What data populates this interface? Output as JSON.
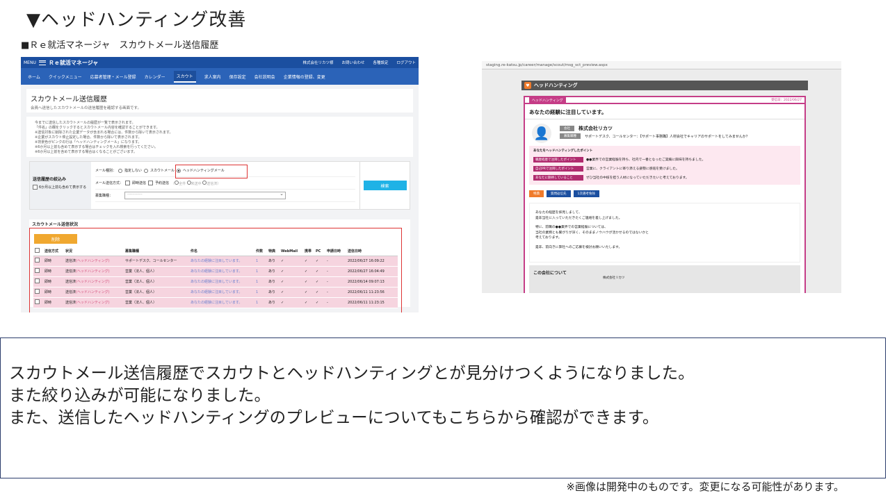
{
  "slide": {
    "title": "▼ヘッドハンティング改善",
    "subtitle": "■Ｒｅ就活マネージャ　スカウトメール送信履歴"
  },
  "left": {
    "topbar": {
      "menu": "MENU",
      "brand": "Ｒｅ就活マネージャ",
      "items": [
        "株式会社リカツ様",
        "お問い合わせ",
        "各種設定",
        "ログアウト"
      ]
    },
    "nav": [
      "ホーム",
      "クイックメニュー",
      "応募者管理・メール登録",
      "カレンダー",
      "スカウト",
      "求人案内",
      "保存設定",
      "会社説明会",
      "企業情報の登録、変更"
    ],
    "page_title": "スカウトメール送信履歴",
    "page_desc": "会員へ送信したスカウトメールの送信履歴を確認する画面です。",
    "notes": [
      "今までに送信したスカウトメールの履歴が一覧で表示されます。",
      "「件名」の欄をクリックするとスカウトメール内容を確認することができます。",
      "※送信対象に削除された企業データが含まれる場合には、件数から除いて表示されます。",
      "※企業がスカウト停止設定した場合、件数から除いて表示されます。",
      "※背景色がピンクの行は「ヘッドハンティングメール」になります。",
      "※6か月以上前も含めて表示する場合はチェックを入れ検索を行ってください。",
      "※6か月以上前を含めて表示する場合はくなることがございます。"
    ],
    "filter": {
      "label": "送信履歴の絞込み",
      "checkbox": "6か月以上前も含めて表示する",
      "type_label": "メール種別：",
      "type_options": [
        "指定しない",
        "スカウトメール",
        "ヘッドハンティングメール"
      ],
      "send_label": "メール送信方式：",
      "send_options": [
        "即時送信",
        "予約送信"
      ],
      "send_sub": [
        "全件",
        "未送中",
        "送信済"
      ],
      "job_label": "募集職種：",
      "job_placeholder": "------------",
      "search_button": "検索"
    },
    "status": {
      "title": "スカウトメール送信状況",
      "delete_button": "削除",
      "headers": [
        "",
        "送信方式",
        "状況",
        "募集職種",
        "件名",
        "件数",
        "特典",
        "WebMail",
        "携帯",
        "PC",
        "申請日時",
        "送信日時"
      ],
      "rows": [
        [
          "",
          "即時",
          "送信済",
          "(ヘッドハンティング)",
          "サポートデスク、コールセンター",
          "あなたの経験に注目しています。",
          "1",
          "あり",
          "✓",
          "✓",
          "✓",
          "-",
          "2022/06/27 16:09:22"
        ],
        [
          "",
          "即時",
          "送信済",
          "(ヘッドハンティング)",
          "営業（法人、個人）",
          "あなたの経験に注目しています。",
          "1",
          "あり",
          "✓",
          "✓",
          "✓",
          "-",
          "2022/06/27 16:04:49"
        ],
        [
          "",
          "即時",
          "送信済",
          "(ヘッドハンティング)",
          "営業（法人、個人）",
          "あなたの経験に注目しています。",
          "1",
          "あり",
          "✓",
          "✓",
          "✓",
          "-",
          "2022/06/14 09:07:13"
        ],
        [
          "",
          "即時",
          "送信済",
          "(ヘッドハンティング)",
          "営業（法人、個人）",
          "あなたの経験に注目しています。",
          "1",
          "あり",
          "✓",
          "✓",
          "✓",
          "-",
          "2022/06/11 11:23:56"
        ],
        [
          "",
          "即時",
          "送信済",
          "(ヘッドハンティング)",
          "営業（法人、個人）",
          "あなたの経験に注目しています。",
          "1",
          "あり",
          "✓",
          "✓",
          "✓",
          "-",
          "2022/06/11 11:23:15"
        ]
      ]
    }
  },
  "right": {
    "url": "staging.re-katsu.jp/career/manage/scout/msg_sct_preview.aspx",
    "header": "ヘッドハンティング",
    "tag": "ヘッドハンティング",
    "date": "受信日：2022/06/27",
    "title": "あなたの経験に注目しています。",
    "company_tag": "会社",
    "company": "株式会社リカツ",
    "position_tag": "募集職種",
    "position": "サポートデスク、コールセンター：【サポート事務職】人材会社でキャリアのサポートをしてみませんか？",
    "points_header": "あなたをヘッドハンティングしたポイント",
    "points": [
      [
        "職歴経歴で注目したポイント",
        "●●業界での営業経験を持ち、社内で一番となったご実績に興味を持ちました。"
      ],
      [
        "自己PRで注目したポイント",
        "営業に、クライアントに寄り添える姿勢に感銘を受けました。"
      ],
      [
        "あなたに期待していること",
        "ぜひ当社の中核を担う人材になっていただきたいと考えております。"
      ]
    ],
    "buttons": [
      "特典",
      "質問返信先",
      "1次選考免除"
    ],
    "message": [
      "あなたの経歴を拝見しまして、",
      "是非当社に入っていただきたくご連絡を差し上げました。",
      "",
      "特に、前職の●●業界での営業経験については、",
      "当社の業務とも繋がりが深く、そのままノウハウが活かせるのではないかと",
      "考えております。",
      "",
      "是非、前向きに弊社へのご応募を検討お願いいたします。"
    ],
    "about": "この会社について",
    "about_company": "株式会社リカツ"
  },
  "body_text": [
    "スカウトメール送信履歴でスカウトとヘッドハンティングとが見分けつくようになりました。",
    "また絞り込みが可能になりました。",
    "また、送信したヘッドハンティングのプレビューについてもこちらから確認ができます。"
  ],
  "footnote": "※画像は開発中のものです。変更になる可能性があります。"
}
